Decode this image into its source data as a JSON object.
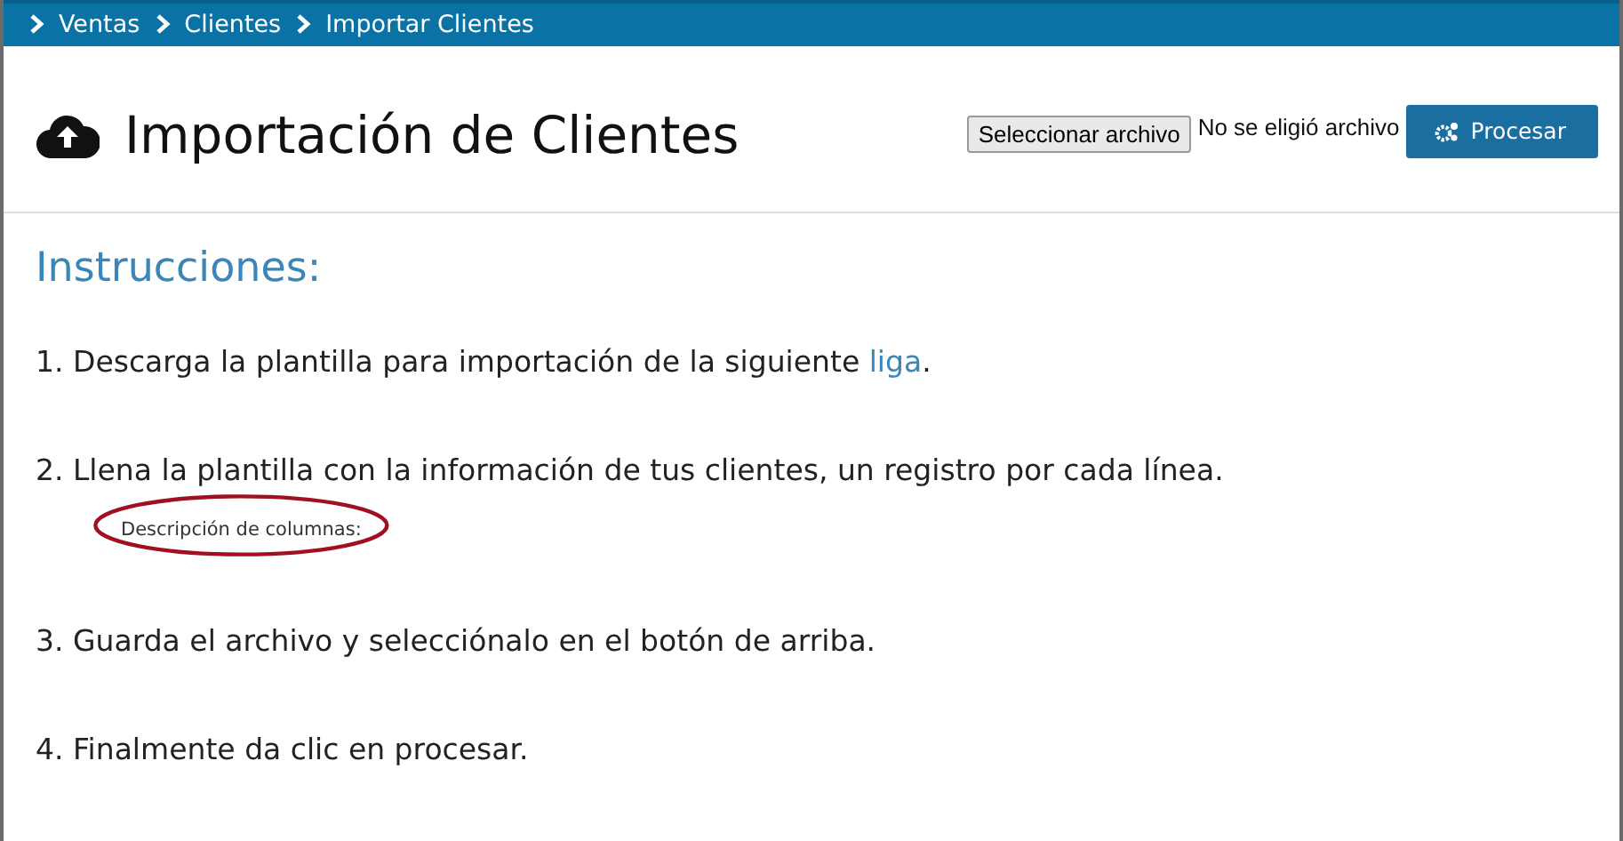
{
  "breadcrumb": [
    {
      "label": "Ventas"
    },
    {
      "label": "Clientes"
    },
    {
      "label": "Importar Clientes"
    }
  ],
  "page_title": "Importación de Clientes",
  "file_input": {
    "button": "Seleccionar archivo",
    "status": "No se eligió archivo"
  },
  "process_button": "Procesar",
  "instructions_title": "Instrucciones:",
  "steps": [
    {
      "parts": [
        {
          "kind": "text",
          "text": "1. Descarga la plantilla para importación de la siguiente "
        },
        {
          "kind": "link",
          "text": "liga"
        },
        {
          "kind": "text",
          "text": "."
        }
      ]
    },
    {
      "parts": [
        {
          "kind": "text",
          "text": "2. Llena la plantilla con la información de tus clientes, un registro por cada línea."
        }
      ],
      "note": {
        "text": "Descripción de columnas:",
        "circled": true
      }
    },
    {
      "parts": [
        {
          "kind": "text",
          "text": "3. Guarda el archivo y selecciónalo en el botón de arriba."
        }
      ]
    },
    {
      "parts": [
        {
          "kind": "text",
          "text": "4. Finalmente da clic en procesar."
        }
      ]
    }
  ]
}
